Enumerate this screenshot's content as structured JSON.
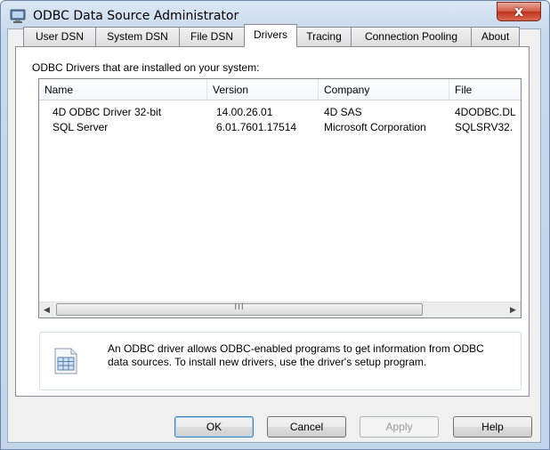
{
  "window": {
    "title": "ODBC Data Source Administrator",
    "close_label": "x"
  },
  "tabs": [
    {
      "label": "User DSN"
    },
    {
      "label": "System DSN"
    },
    {
      "label": "File DSN"
    },
    {
      "label": "Drivers",
      "active": true
    },
    {
      "label": "Tracing"
    },
    {
      "label": "Connection Pooling"
    },
    {
      "label": "About"
    }
  ],
  "drivers": {
    "group_label": "ODBC Drivers that are installed on your system:",
    "columns": [
      "Name",
      "Version",
      "Company",
      "File"
    ],
    "rows": [
      [
        "4D ODBC Driver 32-bit",
        "14.00.26.01",
        "4D SAS",
        "4DODBC.DL"
      ],
      [
        "SQL Server",
        "6.01.7601.17514",
        "Microsoft Corporation",
        "SQLSRV32."
      ]
    ],
    "scroll_grip": "III"
  },
  "info": {
    "text": "An ODBC driver allows ODBC-enabled programs to get information from ODBC data sources.  To install new drivers, use the driver's setup program."
  },
  "buttons": {
    "ok": "OK",
    "cancel": "Cancel",
    "apply": "Apply",
    "help": "Help"
  },
  "colors": {
    "close_button": "#c8412a",
    "titlebar": "#dbe7f4",
    "default_button_border": "#3c7fb1"
  }
}
